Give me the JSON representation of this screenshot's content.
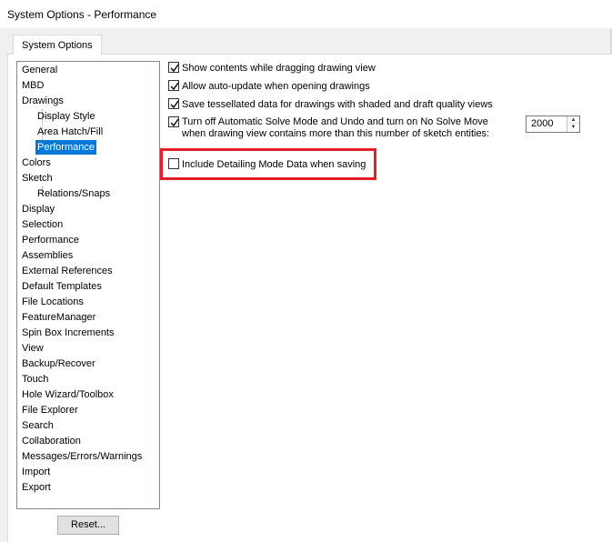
{
  "window": {
    "title": "System Options - Performance"
  },
  "tab": {
    "label": "System Options"
  },
  "tree": {
    "items": [
      {
        "label": "General"
      },
      {
        "label": "MBD"
      },
      {
        "label": "Drawings"
      },
      {
        "label": "Display Style"
      },
      {
        "label": "Area Hatch/Fill"
      },
      {
        "label": "Performance"
      },
      {
        "label": "Colors"
      },
      {
        "label": "Sketch"
      },
      {
        "label": "Relations/Snaps"
      },
      {
        "label": "Display"
      },
      {
        "label": "Selection"
      },
      {
        "label": "Performance"
      },
      {
        "label": "Assemblies"
      },
      {
        "label": "External References"
      },
      {
        "label": "Default Templates"
      },
      {
        "label": "File Locations"
      },
      {
        "label": "FeatureManager"
      },
      {
        "label": "Spin Box Increments"
      },
      {
        "label": "View"
      },
      {
        "label": "Backup/Recover"
      },
      {
        "label": "Touch"
      },
      {
        "label": "Hole Wizard/Toolbox"
      },
      {
        "label": "File Explorer"
      },
      {
        "label": "Search"
      },
      {
        "label": "Collaboration"
      },
      {
        "label": "Messages/Errors/Warnings"
      },
      {
        "label": "Import"
      },
      {
        "label": "Export"
      }
    ],
    "selected": "Performance"
  },
  "reset": {
    "label": "Reset..."
  },
  "options": {
    "show_contents": {
      "label": "Show contents while dragging drawing view",
      "checked": true
    },
    "auto_update": {
      "label": "Allow auto-update when opening drawings",
      "checked": true
    },
    "save_tessellated": {
      "label": "Save tessellated data for drawings with shaded and draft quality views",
      "checked": true
    },
    "turn_off_solve": {
      "label_line1": "Turn off Automatic Solve Mode and Undo and turn on No Solve Move",
      "label_line2": "when drawing view contains more than this number of sketch entities:",
      "checked": true,
      "value": "2000"
    },
    "detailing_mode": {
      "label": "Include Detailing Mode Data when saving",
      "checked": false
    }
  },
  "colors": {
    "highlight": "#e3202a",
    "selection": "#0078d7"
  }
}
